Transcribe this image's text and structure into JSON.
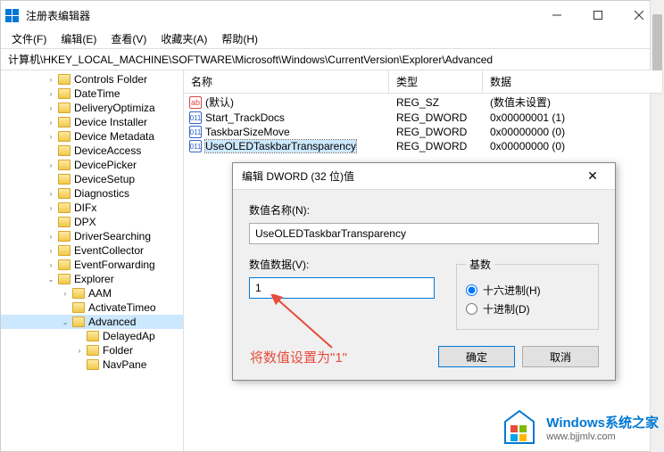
{
  "window": {
    "title": "注册表编辑器"
  },
  "menu": {
    "file": "文件(F)",
    "edit": "编辑(E)",
    "view": "查看(V)",
    "favorites": "收藏夹(A)",
    "help": "帮助(H)"
  },
  "address": "计算机\\HKEY_LOCAL_MACHINE\\SOFTWARE\\Microsoft\\Windows\\CurrentVersion\\Explorer\\Advanced",
  "tree": [
    {
      "level": 1,
      "exp": ">",
      "label": "Controls Folder"
    },
    {
      "level": 1,
      "exp": ">",
      "label": "DateTime"
    },
    {
      "level": 1,
      "exp": ">",
      "label": "DeliveryOptimiza"
    },
    {
      "level": 1,
      "exp": ">",
      "label": "Device Installer"
    },
    {
      "level": 1,
      "exp": ">",
      "label": "Device Metadata"
    },
    {
      "level": 1,
      "exp": "",
      "label": "DeviceAccess"
    },
    {
      "level": 1,
      "exp": ">",
      "label": "DevicePicker"
    },
    {
      "level": 1,
      "exp": "",
      "label": "DeviceSetup"
    },
    {
      "level": 1,
      "exp": ">",
      "label": "Diagnostics"
    },
    {
      "level": 1,
      "exp": ">",
      "label": "DIFx"
    },
    {
      "level": 1,
      "exp": "",
      "label": "DPX"
    },
    {
      "level": 1,
      "exp": ">",
      "label": "DriverSearching"
    },
    {
      "level": 1,
      "exp": ">",
      "label": "EventCollector"
    },
    {
      "level": 1,
      "exp": ">",
      "label": "EventForwarding"
    },
    {
      "level": 1,
      "exp": "v",
      "label": "Explorer"
    },
    {
      "level": 2,
      "exp": ">",
      "label": "AAM"
    },
    {
      "level": 2,
      "exp": "",
      "label": "ActivateTimeo"
    },
    {
      "level": 2,
      "exp": "v",
      "label": "Advanced",
      "selected": true
    },
    {
      "level": 3,
      "exp": "",
      "label": "DelayedAp"
    },
    {
      "level": 3,
      "exp": ">",
      "label": "Folder"
    },
    {
      "level": 3,
      "exp": "",
      "label": "NavPane"
    }
  ],
  "columns": {
    "name": "名称",
    "type": "类型",
    "data": "数据"
  },
  "values": [
    {
      "icon": "sz",
      "name": "(默认)",
      "type": "REG_SZ",
      "data": "(数值未设置)"
    },
    {
      "icon": "dw",
      "name": "Start_TrackDocs",
      "type": "REG_DWORD",
      "data": "0x00000001 (1)"
    },
    {
      "icon": "dw",
      "name": "TaskbarSizeMove",
      "type": "REG_DWORD",
      "data": "0x00000000 (0)"
    },
    {
      "icon": "dw",
      "name": "UseOLEDTaskbarTransparency",
      "type": "REG_DWORD",
      "data": "0x00000000 (0)",
      "selected": true
    }
  ],
  "dialog": {
    "title": "编辑 DWORD (32 位)值",
    "name_label": "数值名称(N):",
    "name_value": "UseOLEDTaskbarTransparency",
    "data_label": "数值数据(V):",
    "data_value": "1",
    "base_label": "基数",
    "hex_label": "十六进制(H)",
    "dec_label": "十进制(D)",
    "ok": "确定",
    "cancel": "取消"
  },
  "annotation": "将数值设置为\"1\"",
  "watermark": {
    "line1": "Windows系统之家",
    "line2": "www.bjjmlv.com"
  }
}
